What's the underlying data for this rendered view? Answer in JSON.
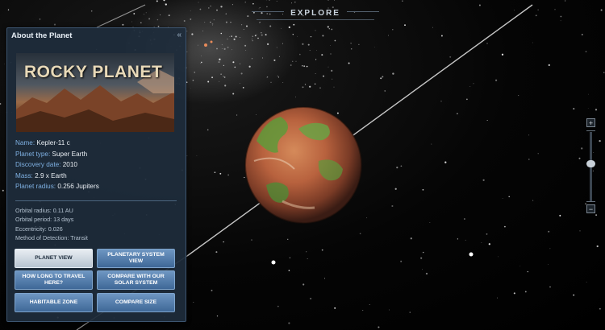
{
  "header": {
    "tab_label": "EXPLORE"
  },
  "panel": {
    "title": "About the Planet",
    "collapse_glyph": "«",
    "banner_text": "ROCKY PLANET",
    "details": [
      {
        "label": "Name:",
        "value": "Kepler-11 c"
      },
      {
        "label": "Planet type:",
        "value": "Super Earth"
      },
      {
        "label": "Discovery date:",
        "value": "2010"
      },
      {
        "label": "Mass:",
        "value": "2.9 x Earth"
      },
      {
        "label": "Planet radius:",
        "value": "0.256 Jupiters"
      }
    ],
    "orbit_details": [
      "Orbital radius: 0.11 AU",
      "Orbital period: 13 days",
      "Eccentricity: 0.026",
      "Method of Detection: Transit"
    ],
    "buttons": {
      "planet_view": "PLANET VIEW",
      "planetary_system_view": "PLANETARY SYSTEM VIEW",
      "travel": "HOW LONG TO TRAVEL HERE?",
      "compare_solar": "COMPARE WITH OUR SOLAR SYSTEM",
      "habitable_zone": "HABITABLE ZONE",
      "compare_size": "COMPARE SIZE"
    }
  },
  "zoom": {
    "plus": "+",
    "minus": "−",
    "level": 0.55
  },
  "colors": {
    "panel_bg": "#1e2c3c",
    "label_blue": "#7fb1e3",
    "button_blue": "#4f78a8",
    "button_active": "#d4dde6"
  }
}
